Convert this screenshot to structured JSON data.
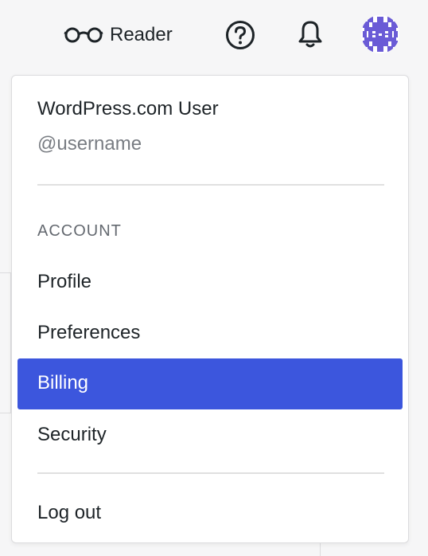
{
  "masterbar": {
    "reader_label": "Reader",
    "reader_icon": "glasses-icon",
    "help_icon": "help-circle-icon",
    "notifications_icon": "bell-icon",
    "avatar_icon": "avatar"
  },
  "menu": {
    "user_name": "WordPress.com User",
    "username": "@username",
    "section_label": "ACCOUNT",
    "items": [
      {
        "label": "Profile"
      },
      {
        "label": "Preferences"
      },
      {
        "label": "Billing"
      },
      {
        "label": "Security"
      }
    ],
    "logout_label": "Log out",
    "selected_item": "Billing"
  },
  "colors": {
    "accent": "#3c56dd",
    "avatar": "#6a5bd6",
    "background": "#f6f6f7",
    "text": "#1d2327",
    "muted_text": "#787c82"
  }
}
